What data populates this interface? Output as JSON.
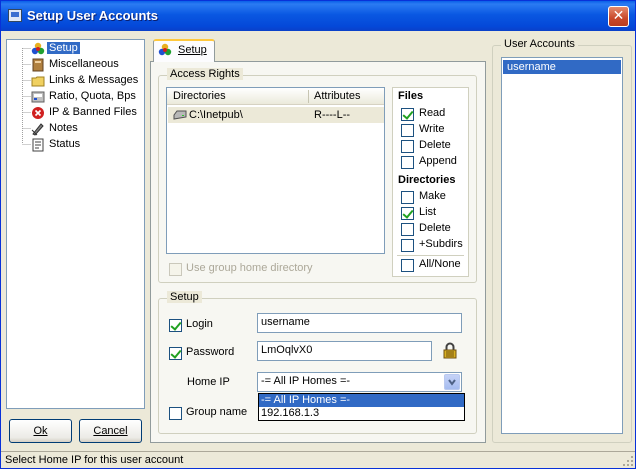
{
  "window": {
    "title": "Setup User Accounts",
    "close_glyph": "✕"
  },
  "tree": {
    "items": [
      {
        "label": "Setup",
        "icon": "setup-icon",
        "selected": true
      },
      {
        "label": "Miscellaneous",
        "icon": "misc-icon"
      },
      {
        "label": "Links & Messages",
        "icon": "folder-icon"
      },
      {
        "label": "Ratio, Quota, Bps",
        "icon": "ratio-icon"
      },
      {
        "label": "IP & Banned Files",
        "icon": "banned-icon"
      },
      {
        "label": "Notes",
        "icon": "notes-icon"
      },
      {
        "label": "Status",
        "icon": "status-icon"
      }
    ]
  },
  "tab": {
    "label": "Setup"
  },
  "access_rights": {
    "group_label": "Access Rights",
    "columns": [
      "Directories",
      "Attributes"
    ],
    "rows": [
      {
        "directory": "C:\\Inetpub\\",
        "attributes": "R----L--"
      }
    ],
    "use_group_home": "Use group home directory"
  },
  "files": {
    "heading": "Files",
    "read": "Read",
    "write": "Write",
    "delete": "Delete",
    "append": "Append"
  },
  "directories": {
    "heading": "Directories",
    "make": "Make",
    "list": "List",
    "delete": "Delete",
    "subdirs": "+Subdirs",
    "allnone": "All/None"
  },
  "setup_group": {
    "label": "Setup",
    "login_label": "Login",
    "login_value": "username",
    "password_label": "Password",
    "password_value": "LmOqlvX0",
    "home_ip_label": "Home IP",
    "home_ip_value": "-= All IP Homes =-",
    "home_ip_options": [
      "-= All IP Homes =-",
      "192.168.1.3"
    ],
    "group_name_label": "Group name"
  },
  "buttons": {
    "ok": "Ok",
    "cancel": "Cancel"
  },
  "user_accounts": {
    "label": "User Accounts",
    "items": [
      "username"
    ]
  },
  "status": {
    "text": "Select Home IP for this user account"
  },
  "colors": {
    "title_bar": "#0a58e2",
    "selection": "#316ac5",
    "tab_highlight": "#ffc83c"
  }
}
